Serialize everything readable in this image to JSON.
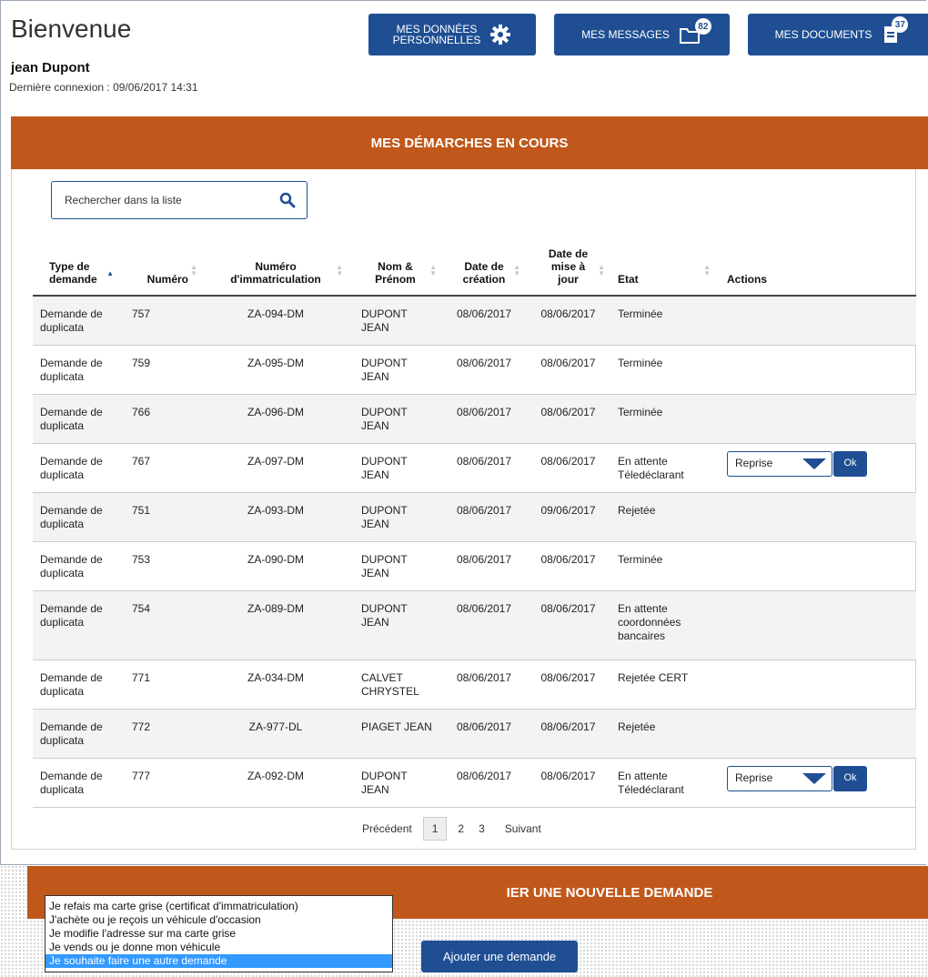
{
  "header": {
    "title": "Bienvenue",
    "user_name": "jean Dupont",
    "last_login": "Dernière connexion : 09/06/2017 14:31"
  },
  "top_buttons": {
    "personal_line1": "MES DONNÉES",
    "personal_line2": "PERSONNELLES",
    "messages_label": "MES MESSAGES",
    "messages_count": "82",
    "documents_label": "MES DOCUMENTS",
    "documents_count": "37"
  },
  "section_title": "MES DÉMARCHES EN COURS",
  "search": {
    "placeholder": "Rechercher dans la liste"
  },
  "table": {
    "headers": {
      "type": [
        "Type de",
        "demande"
      ],
      "numero": [
        "Numéro"
      ],
      "immat": [
        "Numéro",
        "d'immatriculation"
      ],
      "nom": [
        "Nom &",
        "Prénom"
      ],
      "creation": [
        "Date de",
        "création"
      ],
      "maj": [
        "Date de",
        "mise à",
        "jour"
      ],
      "etat": [
        "Etat"
      ],
      "actions": [
        "Actions"
      ]
    },
    "rows": [
      {
        "type": [
          "Demande de",
          "duplicata"
        ],
        "numero": "757",
        "immat": "ZA-094-DM",
        "nom": [
          "DUPONT",
          "JEAN"
        ],
        "creation": "08/06/2017",
        "maj": "08/06/2017",
        "etat": [
          "Terminée"
        ]
      },
      {
        "type": [
          "Demande de",
          "duplicata"
        ],
        "numero": "759",
        "immat": "ZA-095-DM",
        "nom": [
          "DUPONT",
          "JEAN"
        ],
        "creation": "08/06/2017",
        "maj": "08/06/2017",
        "etat": [
          "Terminée"
        ]
      },
      {
        "type": [
          "Demande de",
          "duplicata"
        ],
        "numero": "766",
        "immat": "ZA-096-DM",
        "nom": [
          "DUPONT",
          "JEAN"
        ],
        "creation": "08/06/2017",
        "maj": "08/06/2017",
        "etat": [
          "Terminée"
        ]
      },
      {
        "type": [
          "Demande de",
          "duplicata"
        ],
        "numero": "767",
        "immat": "ZA-097-DM",
        "nom": [
          "DUPONT",
          "JEAN"
        ],
        "creation": "08/06/2017",
        "maj": "08/06/2017",
        "etat": [
          "En attente",
          "Téledéclarant"
        ],
        "action": {
          "select": "Reprise",
          "ok": "Ok"
        }
      },
      {
        "type": [
          "Demande de",
          "duplicata"
        ],
        "numero": "751",
        "immat": "ZA-093-DM",
        "nom": [
          "DUPONT",
          "JEAN"
        ],
        "creation": "08/06/2017",
        "maj": "09/06/2017",
        "etat": [
          "Rejetée"
        ]
      },
      {
        "type": [
          "Demande de",
          "duplicata"
        ],
        "numero": "753",
        "immat": "ZA-090-DM",
        "nom": [
          "DUPONT",
          "JEAN"
        ],
        "creation": "08/06/2017",
        "maj": "08/06/2017",
        "etat": [
          "Terminée"
        ]
      },
      {
        "type": [
          "Demande de",
          "duplicata"
        ],
        "numero": "754",
        "immat": "ZA-089-DM",
        "nom": [
          "DUPONT",
          "JEAN"
        ],
        "creation": "08/06/2017",
        "maj": "08/06/2017",
        "etat": [
          "En attente",
          "coordonnées",
          "bancaires"
        ]
      },
      {
        "type": [
          "Demande de",
          "duplicata"
        ],
        "numero": "771",
        "immat": "ZA-034-DM",
        "nom": [
          "CALVET",
          "CHRYSTEL"
        ],
        "creation": "08/06/2017",
        "maj": "08/06/2017",
        "etat": [
          "Rejetée CERT"
        ]
      },
      {
        "type": [
          "Demande de",
          "duplicata"
        ],
        "numero": "772",
        "immat": "ZA-977-DL",
        "nom": [
          "PIAGET JEAN"
        ],
        "creation": "08/06/2017",
        "maj": "08/06/2017",
        "etat": [
          "Rejetée"
        ]
      },
      {
        "type": [
          "Demande de",
          "duplicata"
        ],
        "numero": "777",
        "immat": "ZA-092-DM",
        "nom": [
          "DUPONT",
          "JEAN"
        ],
        "creation": "08/06/2017",
        "maj": "08/06/2017",
        "etat": [
          "En attente",
          "Téledéclarant"
        ],
        "action": {
          "select": "Reprise",
          "ok": "Ok"
        }
      }
    ]
  },
  "pagination": {
    "prev": "Précédent",
    "pages": [
      "1",
      "2",
      "3"
    ],
    "current": "1",
    "next": "Suivant"
  },
  "new_request": {
    "title_partial": "IER UNE NOUVELLE DEMANDE",
    "options": [
      "Je refais ma carte grise (certificat d'immatriculation)",
      "J'achète ou je reçois un véhicule d'occasion",
      "Je modifie l'adresse sur ma carte grise",
      "Je vends ou je donne mon véhicule",
      "Je souhaite faire une autre demande"
    ],
    "highlighted_index": 4,
    "add_button": "Ajouter une demande"
  },
  "colors": {
    "primary": "#1f4e93",
    "banner": "#c0581b",
    "highlight": "#3399ff"
  }
}
